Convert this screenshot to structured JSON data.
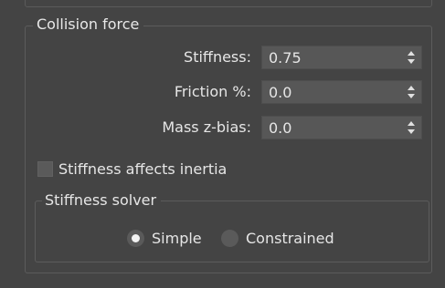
{
  "collision_force": {
    "title": "Collision force",
    "params": [
      {
        "label": "Stiffness:",
        "value": "0.75"
      },
      {
        "label": "Friction %:",
        "value": "0.0"
      },
      {
        "label": "Mass z-bias:",
        "value": "0.0"
      }
    ],
    "stiffness_affects_inertia": {
      "label": "Stiffness affects inertia",
      "checked": false
    },
    "stiffness_solver": {
      "title": "Stiffness solver",
      "options": [
        {
          "label": "Simple",
          "selected": true
        },
        {
          "label": "Constrained",
          "selected": false
        }
      ]
    }
  },
  "colors": {
    "panel_background": "#444444",
    "spinner_background": "#575757",
    "text": "#e6e6e6",
    "group_border": "#5c5c5c"
  }
}
